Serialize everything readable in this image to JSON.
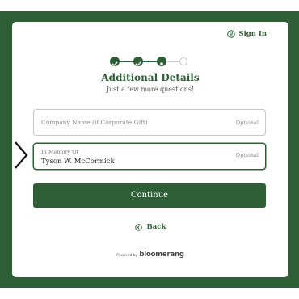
{
  "header": {
    "signin_label": "Sign In"
  },
  "steps": {
    "total": 4,
    "completed": 2,
    "current_step": 3
  },
  "page": {
    "title": "Additional Details",
    "subtitle": "Just a few more questions!"
  },
  "fields": {
    "company": {
      "placeholder": "Company Name (if Corporate Gift)",
      "optional_label": "Optional"
    },
    "memory": {
      "label": "In Memory Of",
      "value": "Tyson W. McCormick",
      "optional_label": "Optional"
    }
  },
  "actions": {
    "continue_label": "Continue",
    "back_label": "Back"
  },
  "footer": {
    "powered_by": "Powered by",
    "brand": "bloomerang"
  },
  "colors": {
    "primary": "#2d5e35",
    "frame": "#2d5e35"
  }
}
